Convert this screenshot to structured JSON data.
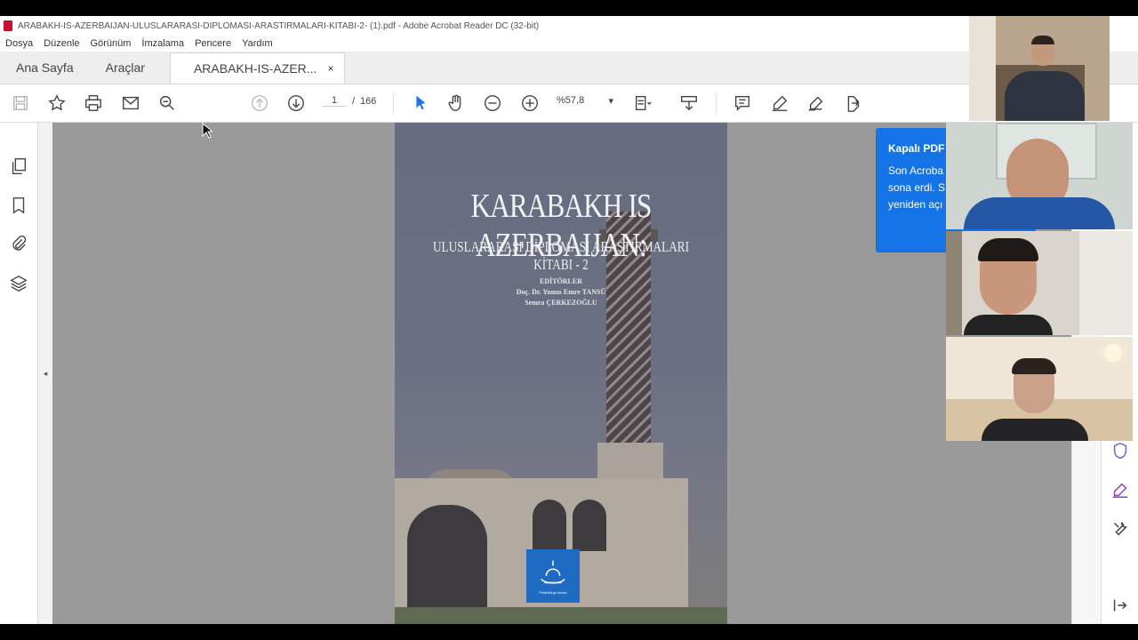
{
  "window": {
    "title": "ARABAKH-IS-AZERBAIJAN-ULUSLARARASI-DIPLOMASI-ARASTIRMALARI-KITABI-2- (1).pdf - Adobe Acrobat Reader DC (32-bit)"
  },
  "menu": [
    "Dosya",
    "Düzenle",
    "Görünüm",
    "İmzalama",
    "Pencere",
    "Yardım"
  ],
  "tabs": {
    "home": "Ana Sayfa",
    "tools": "Araçlar",
    "document": "ARABAKH-IS-AZER...",
    "close": "×"
  },
  "toolbar": {
    "page_current": "1",
    "page_separator": "/",
    "page_total": "166",
    "zoom": "%57,8",
    "zoom_caret": "▾"
  },
  "document": {
    "title": "KARABAKH IS AZERBAIJAN:",
    "subtitle": "ULUSLARARASI DİPLOMASİ ARAŞTIRMALARI KİTABI - 2",
    "editors_label": "EDİTÖRLER",
    "editor_1": "Doç. Dr. Yunus Emre TANSÜ",
    "editor_2": "Semra ÇERKEZOĞLU",
    "publisher_logo_text": "Publishing House"
  },
  "notice": {
    "title": "Kapalı PDF",
    "line1": "Son Acroba",
    "line2": "sona erdi. S",
    "line3": "yeniden açı"
  },
  "collapse_arrow": "◂",
  "colors": {
    "acrobat_red": "#c8102e",
    "notice_blue": "#1473e6",
    "viewer_gray": "#9a9a9a",
    "select_blue": "#1473e6"
  }
}
